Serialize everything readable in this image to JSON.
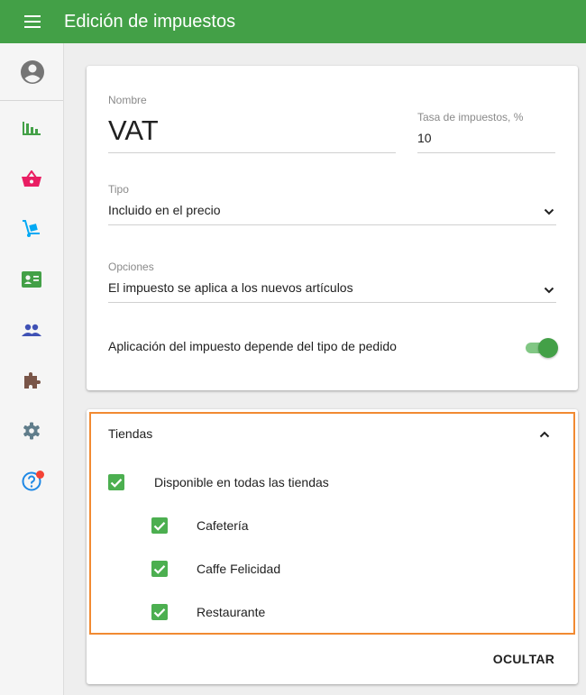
{
  "appbar": {
    "title": "Edición de impuestos",
    "color": "#43a047"
  },
  "sidebar": {
    "items": [
      {
        "icon": "account-circle-icon"
      },
      {
        "icon": "reports-icon",
        "color": "#43a047"
      },
      {
        "icon": "basket-icon",
        "color": "#e91e63"
      },
      {
        "icon": "inventory-icon",
        "color": "#03a9f4"
      },
      {
        "icon": "employee-card-icon",
        "color": "#43a047"
      },
      {
        "icon": "customers-icon",
        "color": "#3f51b5"
      },
      {
        "icon": "integrations-icon",
        "color": "#795548"
      },
      {
        "icon": "settings-icon",
        "color": "#607d8b"
      },
      {
        "icon": "help-icon",
        "color": "#1e88e5"
      }
    ]
  },
  "form": {
    "name_label": "Nombre",
    "name_value": "VAT",
    "rate_label": "Tasa de impuestos, %",
    "rate_value": "10",
    "type_label": "Tipo",
    "type_value": "Incluido en el precio",
    "options_label": "Opciones",
    "options_value": "El impuesto se aplica a los nuevos artículos",
    "order_type_toggle_label": "Aplicación del impuesto depende del tipo de pedido",
    "order_type_toggle_on": true
  },
  "stores": {
    "title": "Tiendas",
    "all_stores_label": "Disponible en todas las tiendas",
    "all_stores_checked": true,
    "items": [
      {
        "label": "Cafetería",
        "checked": true
      },
      {
        "label": "Caffe Felicidad",
        "checked": true
      },
      {
        "label": "Restaurante",
        "checked": true
      }
    ],
    "hide_label": "OCULTAR"
  }
}
